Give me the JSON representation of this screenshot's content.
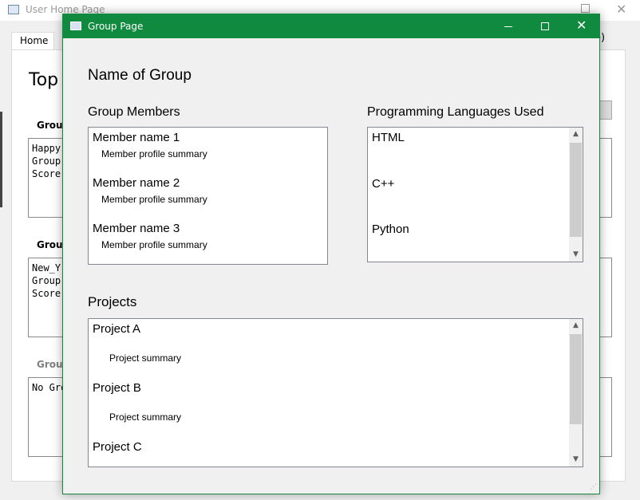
{
  "background_window": {
    "title": "User Home Page",
    "tab_home": "Home",
    "tab_right_fragment": "re)",
    "heading_fragment": "Top",
    "groups": [
      {
        "label": "Group",
        "text": "Happy\nGroup\nScore:"
      },
      {
        "label": "Group",
        "text": "New_Y\nGroup\nScore:"
      },
      {
        "label": "Group",
        "text": "No Gro"
      }
    ]
  },
  "dialog": {
    "title": "Group Page",
    "accent_color": "#0f8a3e",
    "group_name": "Name of Group",
    "members_heading": "Group Members",
    "members": [
      {
        "name": "Member name 1",
        "summary": "Member profile summary"
      },
      {
        "name": "Member name 2",
        "summary": "Member profile summary"
      },
      {
        "name": "Member name 3",
        "summary": "Member profile summary"
      }
    ],
    "languages_heading": "Programming Languages Used",
    "languages": [
      "HTML",
      "C++",
      "Python"
    ],
    "projects_heading": "Projects",
    "projects": [
      {
        "name": "Project A",
        "summary": "Project summary"
      },
      {
        "name": "Project B",
        "summary": "Project summary"
      },
      {
        "name": "Project C",
        "summary": ""
      }
    ]
  },
  "icons": [
    "window-icon",
    "minimize-icon",
    "maximize-icon",
    "close-icon",
    "scroll-up-arrow-icon",
    "scroll-down-arrow-icon",
    "resize-grip-icon"
  ]
}
